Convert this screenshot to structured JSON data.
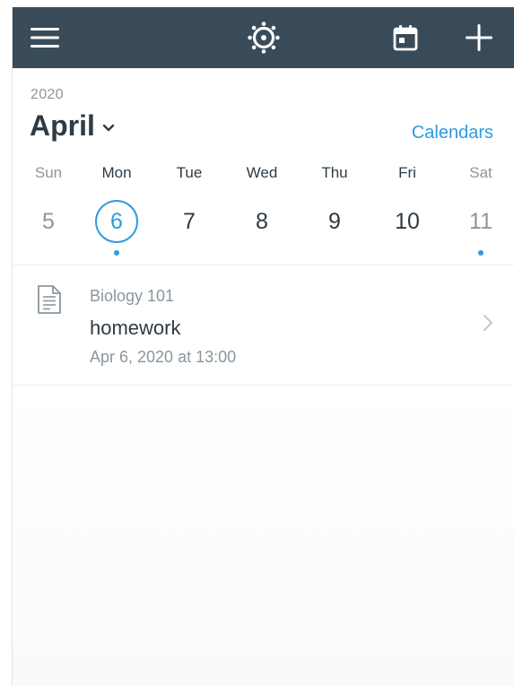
{
  "colors": {
    "navbar": "#394b58",
    "accent": "#2d9be0",
    "text_primary": "#2d3b45",
    "text_secondary": "#8b969e"
  },
  "navbar": {
    "menu_icon": "hamburger-menu-icon",
    "logo_icon": "canvas-logo-icon",
    "calendar_icon": "calendar-today-icon",
    "add_icon": "plus-icon"
  },
  "header": {
    "year": "2020",
    "month": "April",
    "calendars_link": "Calendars"
  },
  "week": {
    "days": [
      {
        "dow": "Sun",
        "date": "5",
        "weekend": true,
        "selected": false,
        "has_event": false
      },
      {
        "dow": "Mon",
        "date": "6",
        "weekend": false,
        "selected": true,
        "has_event": true
      },
      {
        "dow": "Tue",
        "date": "7",
        "weekend": false,
        "selected": false,
        "has_event": false
      },
      {
        "dow": "Wed",
        "date": "8",
        "weekend": false,
        "selected": false,
        "has_event": false
      },
      {
        "dow": "Thu",
        "date": "9",
        "weekend": false,
        "selected": false,
        "has_event": false
      },
      {
        "dow": "Fri",
        "date": "10",
        "weekend": false,
        "selected": false,
        "has_event": false
      },
      {
        "dow": "Sat",
        "date": "11",
        "weekend": true,
        "selected": false,
        "has_event": true
      }
    ]
  },
  "events": [
    {
      "icon": "assignment-document-icon",
      "course": "Biology 101",
      "title": "homework",
      "datetime": "Apr 6, 2020 at 13:00"
    }
  ]
}
